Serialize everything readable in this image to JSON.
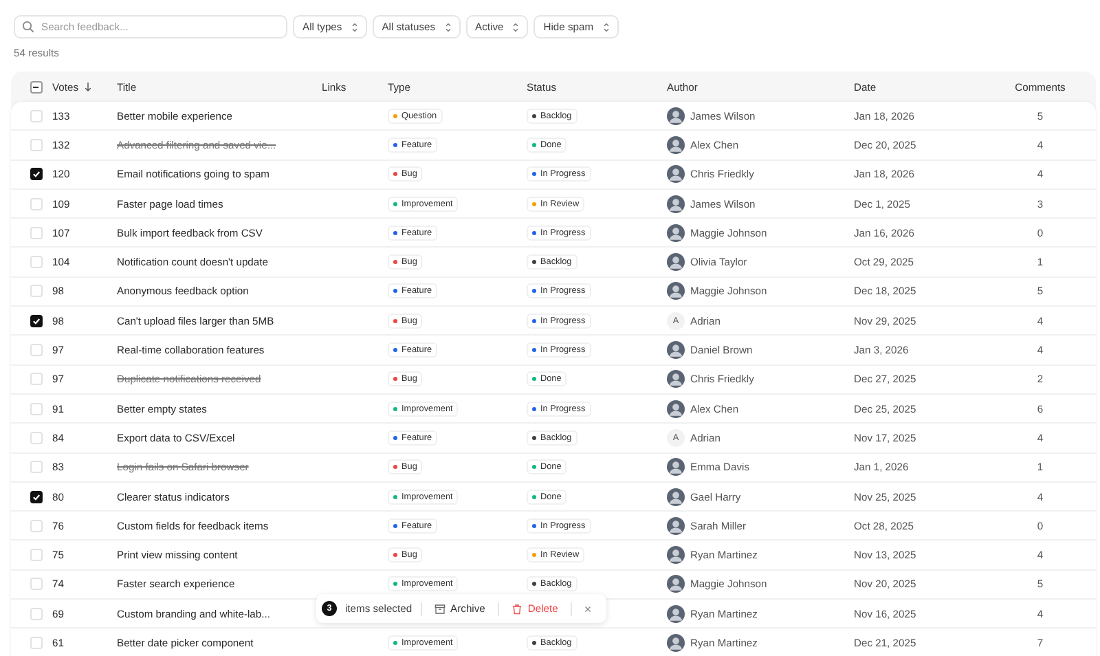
{
  "toolbar": {
    "search": {
      "placeholder": "Search feedback..."
    },
    "filters": [
      "All types",
      "All statuses",
      "Active",
      "Hide spam"
    ]
  },
  "result_count": "54 results",
  "table": {
    "select_all": {
      "indeterminate": true
    },
    "columns": [
      {
        "label": "Votes",
        "sorted": true
      },
      {
        "label": "Title"
      },
      {
        "label": "Links"
      },
      {
        "label": "Type"
      },
      {
        "label": "Status"
      },
      {
        "label": "Author"
      },
      {
        "label": "Date"
      },
      {
        "label": "Comments"
      }
    ],
    "rows": [
      {
        "selected": false,
        "votes": "133",
        "title": "Better mobile experience",
        "struck": false,
        "type": {
          "label": "Question",
          "color": "#f59e0b"
        },
        "status": {
          "label": "Backlog",
          "color": "#3f3f46"
        },
        "author": {
          "name": "James Wilson",
          "kind": "photo"
        },
        "date": "Jan 18, 2026",
        "comments": "5"
      },
      {
        "selected": false,
        "votes": "132",
        "title": "Advanced filtering and saved vie...",
        "struck": true,
        "type": {
          "label": "Feature",
          "color": "#2563eb"
        },
        "status": {
          "label": "Done",
          "color": "#10b981"
        },
        "author": {
          "name": "Alex Chen",
          "kind": "photo"
        },
        "date": "Dec 20, 2025",
        "comments": "4"
      },
      {
        "selected": true,
        "votes": "120",
        "title": "Email notifications going to spam",
        "struck": false,
        "type": {
          "label": "Bug",
          "color": "#ef4444"
        },
        "status": {
          "label": "In Progress",
          "color": "#2563eb"
        },
        "author": {
          "name": "Chris Friedkly",
          "kind": "photo"
        },
        "date": "Jan 18, 2026",
        "comments": "4"
      },
      {
        "selected": false,
        "votes": "109",
        "title": "Faster page load times",
        "struck": false,
        "type": {
          "label": "Improvement",
          "color": "#10b981"
        },
        "status": {
          "label": "In Review",
          "color": "#f59e0b"
        },
        "author": {
          "name": "James Wilson",
          "kind": "photo"
        },
        "date": "Dec 1, 2025",
        "comments": "3"
      },
      {
        "selected": false,
        "votes": "107",
        "title": "Bulk import feedback from CSV",
        "struck": false,
        "type": {
          "label": "Feature",
          "color": "#2563eb"
        },
        "status": {
          "label": "In Progress",
          "color": "#2563eb"
        },
        "author": {
          "name": "Maggie Johnson",
          "kind": "photo"
        },
        "date": "Jan 16, 2026",
        "comments": "0"
      },
      {
        "selected": false,
        "votes": "104",
        "title": "Notification count doesn't update",
        "struck": false,
        "type": {
          "label": "Bug",
          "color": "#ef4444"
        },
        "status": {
          "label": "Backlog",
          "color": "#3f3f46"
        },
        "author": {
          "name": "Olivia Taylor",
          "kind": "photo"
        },
        "date": "Oct 29, 2025",
        "comments": "1"
      },
      {
        "selected": false,
        "votes": "98",
        "title": "Anonymous feedback option",
        "struck": false,
        "type": {
          "label": "Feature",
          "color": "#2563eb"
        },
        "status": {
          "label": "In Progress",
          "color": "#2563eb"
        },
        "author": {
          "name": "Maggie Johnson",
          "kind": "photo"
        },
        "date": "Dec 18, 2025",
        "comments": "5"
      },
      {
        "selected": true,
        "votes": "98",
        "title": "Can't upload files larger than 5MB",
        "struck": false,
        "type": {
          "label": "Bug",
          "color": "#ef4444"
        },
        "status": {
          "label": "In Progress",
          "color": "#2563eb"
        },
        "author": {
          "name": "Adrian",
          "kind": "initial",
          "initial": "A"
        },
        "date": "Nov 29, 2025",
        "comments": "4"
      },
      {
        "selected": false,
        "votes": "97",
        "title": "Real-time collaboration features",
        "struck": false,
        "type": {
          "label": "Feature",
          "color": "#2563eb"
        },
        "status": {
          "label": "In Progress",
          "color": "#2563eb"
        },
        "author": {
          "name": "Daniel Brown",
          "kind": "photo"
        },
        "date": "Jan 3, 2026",
        "comments": "4"
      },
      {
        "selected": false,
        "votes": "97",
        "title": "Duplicate notifications received",
        "struck": true,
        "type": {
          "label": "Bug",
          "color": "#ef4444"
        },
        "status": {
          "label": "Done",
          "color": "#10b981"
        },
        "author": {
          "name": "Chris Friedkly",
          "kind": "photo"
        },
        "date": "Dec 27, 2025",
        "comments": "2"
      },
      {
        "selected": false,
        "votes": "91",
        "title": "Better empty states",
        "struck": false,
        "type": {
          "label": "Improvement",
          "color": "#10b981"
        },
        "status": {
          "label": "In Progress",
          "color": "#2563eb"
        },
        "author": {
          "name": "Alex Chen",
          "kind": "photo"
        },
        "date": "Dec 25, 2025",
        "comments": "6"
      },
      {
        "selected": false,
        "votes": "84",
        "title": "Export data to CSV/Excel",
        "struck": false,
        "type": {
          "label": "Feature",
          "color": "#2563eb"
        },
        "status": {
          "label": "Backlog",
          "color": "#3f3f46"
        },
        "author": {
          "name": "Adrian",
          "kind": "initial",
          "initial": "A"
        },
        "date": "Nov 17, 2025",
        "comments": "4"
      },
      {
        "selected": false,
        "votes": "83",
        "title": "Login fails on Safari browser",
        "struck": true,
        "type": {
          "label": "Bug",
          "color": "#ef4444"
        },
        "status": {
          "label": "Done",
          "color": "#10b981"
        },
        "author": {
          "name": "Emma Davis",
          "kind": "photo"
        },
        "date": "Jan 1, 2026",
        "comments": "1"
      },
      {
        "selected": true,
        "votes": "80",
        "title": "Clearer status indicators",
        "struck": false,
        "type": {
          "label": "Improvement",
          "color": "#10b981"
        },
        "status": {
          "label": "Done",
          "color": "#10b981"
        },
        "author": {
          "name": "Gael Harry",
          "kind": "photo"
        },
        "date": "Nov 25, 2025",
        "comments": "4"
      },
      {
        "selected": false,
        "votes": "76",
        "title": "Custom fields for feedback items",
        "struck": false,
        "type": {
          "label": "Feature",
          "color": "#2563eb"
        },
        "status": {
          "label": "In Progress",
          "color": "#2563eb"
        },
        "author": {
          "name": "Sarah Miller",
          "kind": "photo"
        },
        "date": "Oct 28, 2025",
        "comments": "0"
      },
      {
        "selected": false,
        "votes": "75",
        "title": "Print view missing content",
        "struck": false,
        "type": {
          "label": "Bug",
          "color": "#ef4444"
        },
        "status": {
          "label": "In Review",
          "color": "#f59e0b"
        },
        "author": {
          "name": "Ryan Martinez",
          "kind": "photo"
        },
        "date": "Nov 13, 2025",
        "comments": "4"
      },
      {
        "selected": false,
        "votes": "74",
        "title": "Faster search experience",
        "struck": false,
        "type": {
          "label": "Improvement",
          "color": "#10b981"
        },
        "status": {
          "label": "Backlog",
          "color": "#3f3f46"
        },
        "author": {
          "name": "Maggie Johnson",
          "kind": "photo"
        },
        "date": "Nov 20, 2025",
        "comments": "5"
      },
      {
        "selected": false,
        "votes": "69",
        "title": "Custom branding and white-lab...",
        "struck": false,
        "author": {
          "name": "Ryan Martinez",
          "kind": "photo"
        },
        "date": "Nov 16, 2025",
        "comments": "4"
      },
      {
        "selected": false,
        "votes": "61",
        "title": "Better date picker component",
        "struck": false,
        "type": {
          "label": "Improvement",
          "color": "#10b981"
        },
        "status": {
          "label": "Backlog",
          "color": "#3f3f46"
        },
        "author": {
          "name": "Ryan Martinez",
          "kind": "photo"
        },
        "date": "Dec 21, 2025",
        "comments": "7"
      }
    ]
  },
  "selection_bar": {
    "count": "3",
    "label": "items selected",
    "actions": [
      {
        "label": "Archive",
        "kind": "archive"
      },
      {
        "label": "Delete",
        "kind": "delete"
      }
    ],
    "close": "×"
  }
}
